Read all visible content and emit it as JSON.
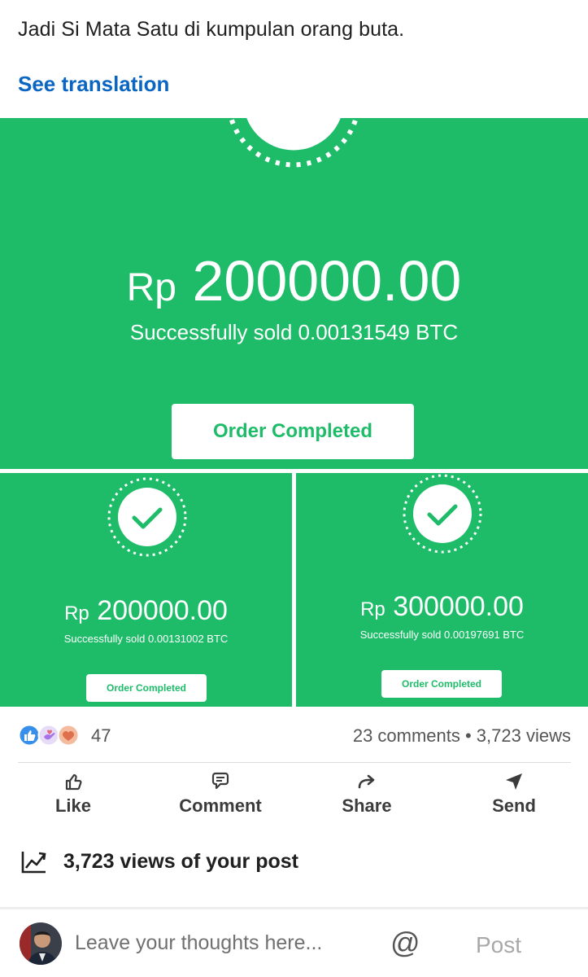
{
  "post": {
    "text": "Jadi Si Mata Satu di kumpulan orang buta.",
    "see_translation": "See translation"
  },
  "image": {
    "main": {
      "currency": "Rp",
      "amount": "200000.00",
      "sold_text": "Successfully sold  0.00131549 BTC",
      "button_label": "Order Completed"
    },
    "left": {
      "currency": "Rp",
      "amount": "200000.00",
      "sold_text": "Successfully sold  0.00131002 BTC",
      "button_label": "Order Completed"
    },
    "right": {
      "currency": "Rp",
      "amount": "300000.00",
      "sold_text": "Successfully sold  0.00197691 BTC",
      "button_label": "Order Completed"
    },
    "colors": {
      "green": "#1ebc69",
      "white": "#ffffff"
    }
  },
  "social": {
    "reaction_count": "47",
    "stats": "23 comments • 3,723 views",
    "reaction_icons": [
      "like-icon",
      "support-icon",
      "love-icon"
    ]
  },
  "actions": {
    "like": "Like",
    "comment": "Comment",
    "share": "Share",
    "send": "Send"
  },
  "analytics": {
    "views_text": "3,723 views of your post"
  },
  "comment_bar": {
    "placeholder": "Leave your thoughts here...",
    "mention_symbol": "@",
    "post_label": "Post"
  },
  "accent_colors": {
    "link": "#0a66c2",
    "text": "#202020",
    "muted": "#555555"
  }
}
